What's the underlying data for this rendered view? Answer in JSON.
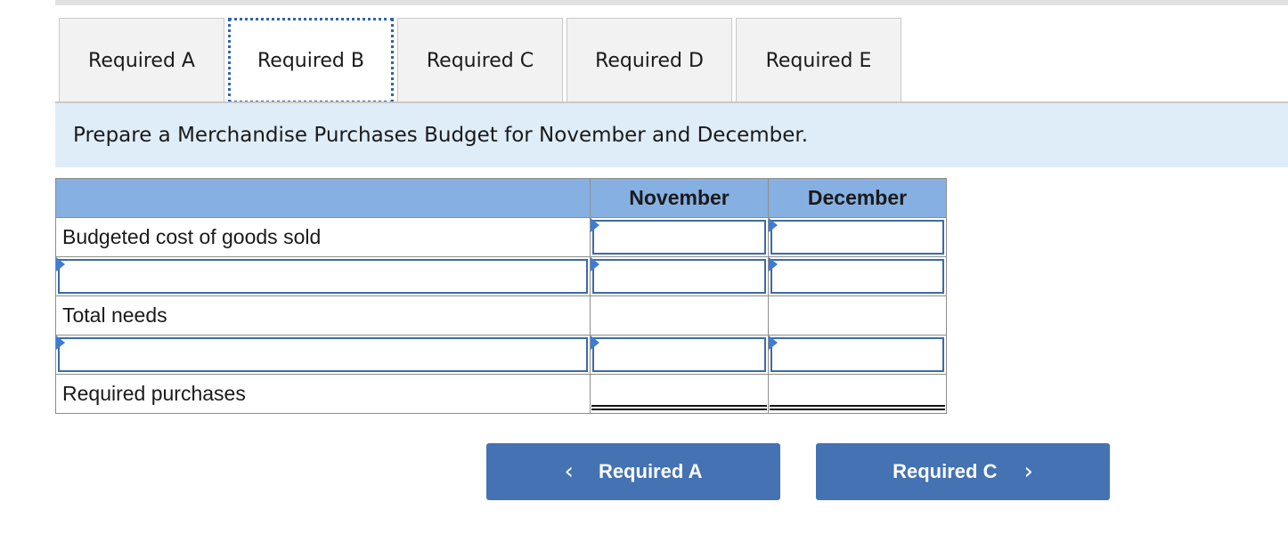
{
  "tabs": [
    {
      "label": "Required A",
      "active": false
    },
    {
      "label": "Required B",
      "active": true
    },
    {
      "label": "Required C",
      "active": false
    },
    {
      "label": "Required D",
      "active": false
    },
    {
      "label": "Required E",
      "active": false
    }
  ],
  "instruction": "Prepare a Merchandise Purchases Budget for November and December.",
  "table": {
    "columns": [
      "",
      "November",
      "December"
    ],
    "rows": [
      {
        "label": "Budgeted cost of goods sold",
        "label_editable": false,
        "november": "",
        "december": "",
        "values_editable": true
      },
      {
        "label": "",
        "label_editable": true,
        "november": "",
        "december": "",
        "values_editable": true
      },
      {
        "label": "Total needs",
        "label_editable": false,
        "november": "",
        "december": "",
        "values_editable": false
      },
      {
        "label": "",
        "label_editable": true,
        "november": "",
        "december": "",
        "values_editable": true
      },
      {
        "label": "Required purchases",
        "label_editable": false,
        "november": "",
        "december": "",
        "values_editable": false,
        "total": true
      }
    ]
  },
  "nav": {
    "prev_label": "Required A",
    "prev_icon": "‹",
    "next_label": "Required C",
    "next_icon": "›"
  },
  "colors": {
    "header_bg": "#86b0e2",
    "instruction_bg": "#dfedf9",
    "button_bg": "#4472b3",
    "active_tab_border": "#2f63b7"
  }
}
